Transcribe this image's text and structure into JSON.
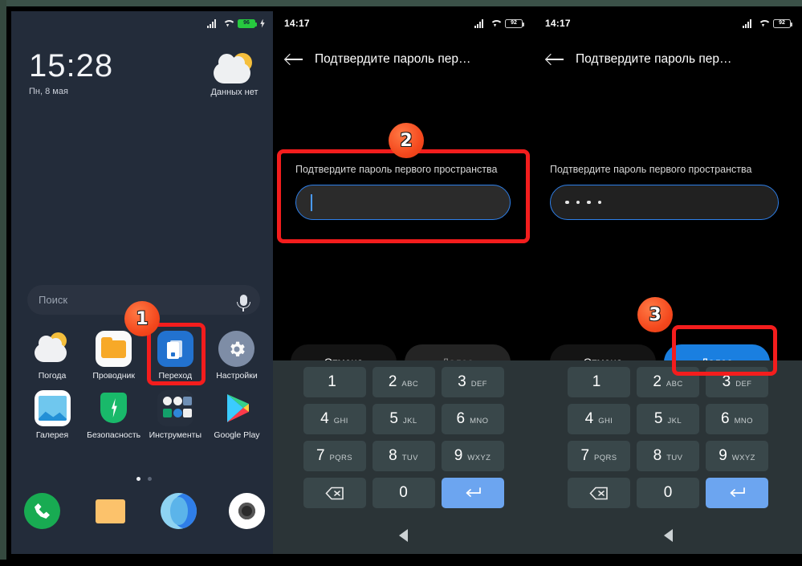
{
  "panel1": {
    "status": {
      "signal": "signal-icon",
      "wifi": "wifi-icon",
      "battery": "battery-icon",
      "charging": "bolt-icon"
    },
    "clock": "15:28",
    "date": "Пн, 8 мая",
    "weather_text": "Данных нет",
    "search_placeholder": "Поиск",
    "apps_row1": [
      {
        "label": "Погода",
        "icon": "weather-app-icon"
      },
      {
        "label": "Проводник",
        "icon": "file-manager-icon"
      },
      {
        "label": "Переход",
        "icon": "second-space-switch-icon"
      },
      {
        "label": "Настройки",
        "icon": "settings-gear-icon"
      }
    ],
    "apps_row2": [
      {
        "label": "Галерея",
        "icon": "gallery-icon"
      },
      {
        "label": "Безопасность",
        "icon": "security-shield-icon"
      },
      {
        "label": "Инструменты",
        "icon": "tools-folder-icon"
      },
      {
        "label": "Google Play",
        "icon": "google-play-icon"
      }
    ],
    "dock": [
      {
        "name": "phone-app-icon"
      },
      {
        "name": "messages-app-icon"
      },
      {
        "name": "browser-app-icon"
      },
      {
        "name": "camera-app-icon"
      }
    ],
    "page_dots": 2,
    "active_dot": 0
  },
  "panel2": {
    "status_time": "14:17",
    "battery_percent": "92",
    "appbar_title": "Подтвердите пароль пер…",
    "field_label": "Подтвердите пароль первого пространства",
    "field_value": "",
    "cancel_label": "Отмена",
    "next_label": "Далее",
    "next_enabled": false,
    "keypad": [
      [
        {
          "num": "1",
          "ltr": ""
        },
        {
          "num": "2",
          "ltr": "ABC"
        },
        {
          "num": "3",
          "ltr": "DEF"
        }
      ],
      [
        {
          "num": "4",
          "ltr": "GHI"
        },
        {
          "num": "5",
          "ltr": "JKL"
        },
        {
          "num": "6",
          "ltr": "MNO"
        }
      ],
      [
        {
          "num": "7",
          "ltr": "PQRS"
        },
        {
          "num": "8",
          "ltr": "TUV"
        },
        {
          "num": "9",
          "ltr": "WXYZ"
        }
      ]
    ],
    "key_delete": "backspace-icon",
    "key_zero": "0",
    "key_enter": "enter-icon",
    "nav_back": "nav-back-triangle-icon"
  },
  "panel3": {
    "status_time": "14:17",
    "battery_percent": "92",
    "appbar_title": "Подтвердите пароль пер…",
    "field_label": "Подтвердите пароль первого пространства",
    "field_value": "••••",
    "field_dot_count": 4,
    "cancel_label": "Отмена",
    "next_label": "Далее",
    "next_enabled": true
  },
  "annotations": {
    "badges": [
      "1",
      "2",
      "3"
    ],
    "highlight_color": "#f41d1d",
    "badge_color": "#f4481d"
  }
}
